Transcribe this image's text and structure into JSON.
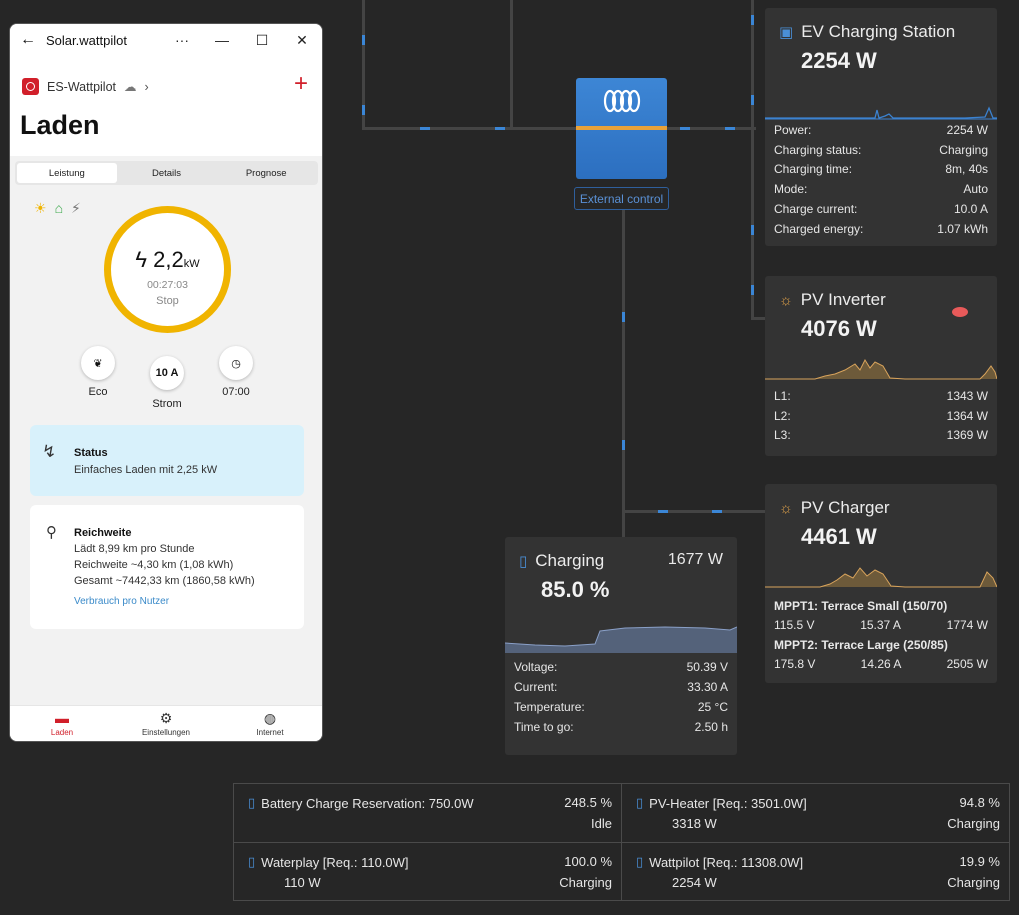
{
  "app": {
    "window_title": "Solar.wattpilot",
    "device_name": "ES-Wattpilot",
    "page_title": "Laden",
    "tabs": [
      "Leistung",
      "Details",
      "Prognose"
    ],
    "power_value": "2,2",
    "power_unit": "kW",
    "elapsed": "00:27:03",
    "stop_label": "Stop",
    "controls": [
      {
        "icon": "leaf-icon",
        "label": "Eco"
      },
      {
        "icon": "current-icon",
        "value": "10 A",
        "label": "Strom"
      },
      {
        "icon": "clock-icon",
        "label": "07:00"
      }
    ],
    "status": {
      "title": "Status",
      "text": "Einfaches Laden mit 2,25 kW"
    },
    "range": {
      "title": "Reichweite",
      "lines": [
        "Lädt 8,99 km pro Stunde",
        "Reichweite ~4,30 km (1,08 kWh)",
        "Gesamt ~7442,33 km (1860,58 kWh)"
      ],
      "link": "Verbrauch pro Nutzer"
    },
    "nav": [
      {
        "label": "Laden",
        "icon": "charger-icon",
        "active": true
      },
      {
        "label": "Einstellungen",
        "icon": "gear-icon",
        "active": false
      },
      {
        "label": "Internet",
        "icon": "globe-icon",
        "active": false
      }
    ],
    "accent": "#d11f2a",
    "ring_color": "#f0b400"
  },
  "victron": {
    "external_control": "External control",
    "stripe_color": "#e8a23a"
  },
  "ev_station": {
    "title": "EV Charging Station",
    "power": "2254 W",
    "rows": [
      [
        "Power:",
        "2254 W"
      ],
      [
        "Charging status:",
        "Charging"
      ],
      [
        "Charging time:",
        "8m, 40s"
      ],
      [
        "Mode:",
        "Auto"
      ],
      [
        "Charge current:",
        "10.0 A"
      ],
      [
        "Charged energy:",
        "1.07 kWh"
      ]
    ]
  },
  "pv_inverter": {
    "title": "PV Inverter",
    "power": "4076 W",
    "rows": [
      [
        "L1:",
        "1343 W"
      ],
      [
        "L2:",
        "1364 W"
      ],
      [
        "L3:",
        "1369 W"
      ]
    ]
  },
  "pv_charger": {
    "title": "PV Charger",
    "power": "4461 W",
    "mppt": [
      {
        "name": "MPPT1: Terrace Small (150/70)",
        "v": "115.5 V",
        "a": "15.37 A",
        "w": "1774 W"
      },
      {
        "name": "MPPT2: Terrace Large (250/85)",
        "v": "175.8 V",
        "a": "14.26 A",
        "w": "2505 W"
      }
    ]
  },
  "battery": {
    "title": "Charging",
    "soc": "85.0 %",
    "power": "1677 W",
    "rows": [
      [
        "Voltage:",
        "50.39 V"
      ],
      [
        "Current:",
        "33.30 A"
      ],
      [
        "Temperature:",
        "25 °C"
      ],
      [
        "Time to go:",
        "2.50 h"
      ]
    ]
  },
  "reservations": [
    {
      "name": "Battery Charge Reservation: 750.0W",
      "pct": "248.5 %",
      "value": "",
      "status": "Idle"
    },
    {
      "name": "PV-Heater [Req.: 3501.0W]",
      "pct": "94.8 %",
      "value": "3318 W",
      "status": "Charging"
    },
    {
      "name": "Waterplay [Req.: 110.0W]",
      "pct": "100.0 %",
      "value": "110 W",
      "status": "Charging"
    },
    {
      "name": "Wattpilot [Req.: 11308.0W]",
      "pct": "19.9 %",
      "value": "2254 W",
      "status": "Charging"
    }
  ]
}
